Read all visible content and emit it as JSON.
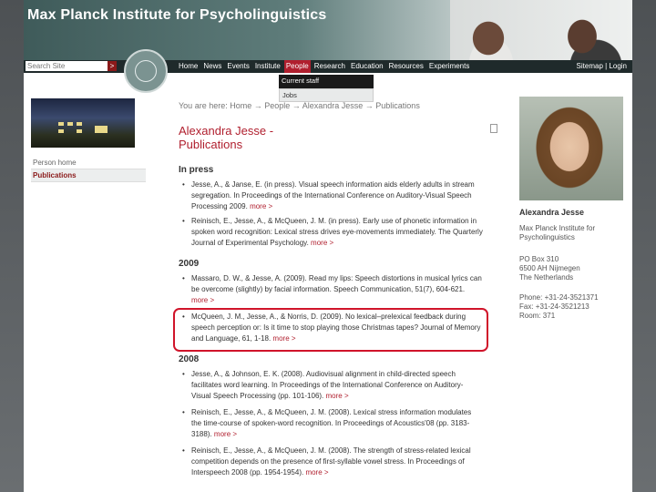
{
  "site": {
    "title": "Max Planck Institute for Psycholinguistics"
  },
  "search": {
    "placeholder": "Search Site",
    "button": ">"
  },
  "nav": {
    "items": [
      "Home",
      "News",
      "Events",
      "Institute",
      "People",
      "Research",
      "Education",
      "Resources",
      "Experiments"
    ],
    "active": "People",
    "right": "Sitemap | Login"
  },
  "dropdown": {
    "items": [
      "Current staff",
      "Jobs"
    ]
  },
  "breadcrumb": "You are here: Home → People → Alexandra Jesse → Publications",
  "page": {
    "title_line1": "Alexandra Jesse -",
    "title_line2": "Publications"
  },
  "left_menu": {
    "items": [
      "Person home",
      "Publications"
    ],
    "selected": "Publications"
  },
  "sections": [
    {
      "heading": "In press",
      "pubs": [
        {
          "text": "Jesse, A., & Janse, E. (in press). Visual speech information aids elderly adults in stream segregation. In Proceedings of the International Conference on Auditory-Visual Speech Processing 2009.",
          "more": "more >"
        },
        {
          "text": "Reinisch, E., Jesse, A., & McQueen, J. M. (in press). Early use of phonetic information in spoken word recognition: Lexical stress drives eye-movements immediately. The Quarterly Journal of Experimental Psychology.",
          "more": "more >"
        }
      ]
    },
    {
      "heading": "2009",
      "pubs": [
        {
          "text": "Massaro, D. W., & Jesse, A. (2009). Read my lips: Speech distortions in musical lyrics can be overcome (slightly) by facial information. Speech Communication, 51(7), 604-621.",
          "more": "more >"
        },
        {
          "text": "McQueen, J. M., Jesse, A., & Norris, D. (2009). No lexical–prelexical feedback during speech perception or: Is it time to stop playing those Christmas tapes? Journal of Memory and Language, 61, 1-18.",
          "more": "more >"
        }
      ]
    },
    {
      "heading": "2008",
      "pubs": [
        {
          "text": "Jesse, A., & Johnson, E. K. (2008). Audiovisual alignment in child-directed speech facilitates word learning. In Proceedings of the International Conference on Auditory-Visual Speech Processing (pp. 101-106).",
          "more": "more >"
        },
        {
          "text": "Reinisch, E., Jesse, A., & McQueen, J. M. (2008). Lexical stress information modulates the time-course of spoken-word recognition. In Proceedings of Acoustics'08 (pp. 3183-3188).",
          "more": "more >"
        },
        {
          "text": "Reinisch, E., Jesse, A., & McQueen, J. M. (2008). The strength of stress-related lexical competition depends on the presence of first-syllable vowel stress. In Proceedings of Interspeech 2008 (pp. 1954-1954).",
          "more": "more >"
        }
      ]
    }
  ],
  "person": {
    "name": "Alexandra Jesse",
    "org_line1": "Max Planck Institute for",
    "org_line2": "Psycholinguistics",
    "addr_line1": "PO Box 310",
    "addr_line2": "6500 AH Nijmegen",
    "addr_line3": "The Netherlands",
    "phone_label": "Phone:",
    "phone": "+31-24-3521371",
    "fax_label": "Fax:",
    "fax": "+31-24-3521213",
    "room_label": "Room:",
    "room": "371"
  },
  "colors": {
    "accent": "#b01f2e",
    "highlight": "#d0142a",
    "nav_bg": "#1f2a2b"
  }
}
